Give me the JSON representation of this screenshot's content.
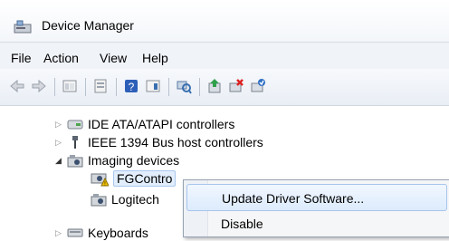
{
  "window": {
    "title": "Device Manager"
  },
  "menu": {
    "file": "File",
    "action": "Action",
    "view": "View",
    "help": "Help"
  },
  "toolbar": {
    "buttons": [
      "back-icon",
      "forward-icon",
      "show-hide-tree-icon",
      "properties-icon",
      "help-icon",
      "action-pane-icon",
      "scan-hardware-icon",
      "update-driver-icon",
      "uninstall-icon",
      "enable-device-icon"
    ]
  },
  "tree": {
    "ide": "IDE ATA/ATAPI controllers",
    "ieee": "IEEE 1394 Bus host controllers",
    "imaging": "Imaging devices",
    "fgcontrol": "FGContro",
    "logitech": "Logitech",
    "keyboards": "Keyboards"
  },
  "context_menu": {
    "update": "Update Driver Software...",
    "disable": "Disable"
  },
  "colors": {
    "highlight": "#e2eefc",
    "accent": "#3a6fb0",
    "warning": "#f2c200"
  }
}
